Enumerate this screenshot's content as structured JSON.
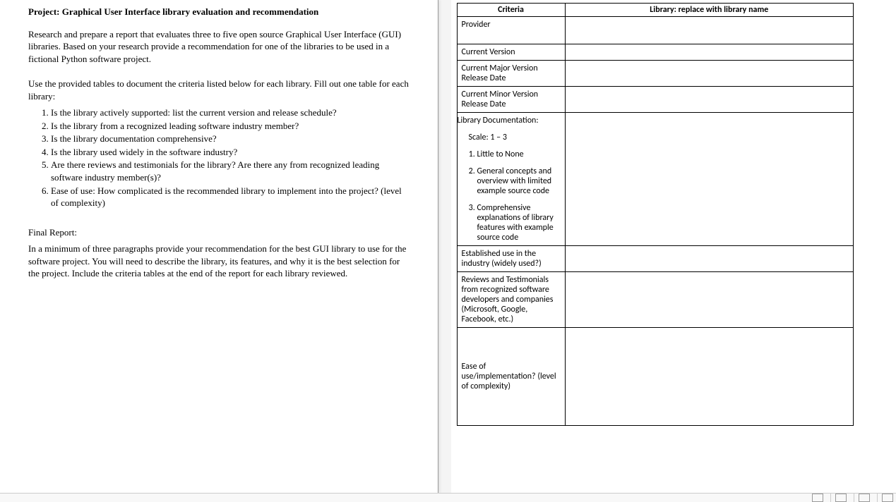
{
  "left": {
    "title": "Project: Graphical User Interface library evaluation and recommendation",
    "intro": "Research and prepare a report that evaluates three to five open source Graphical User Interface (GUI) libraries.  Based on your research provide a recommendation for one of the libraries to be used in a fictional Python software project.",
    "tables_note": "Use the provided tables to document the criteria listed below for each library. Fill out one table for each library:",
    "questions": [
      "Is the library actively supported: list the current version and release schedule?",
      "Is the library from a recognized leading software industry member?",
      "Is the library documentation comprehensive?",
      "Is the library used widely in the software industry?",
      "Are there reviews and testimonials for the library?  Are there any from recognized leading software industry member(s)?",
      "Ease of use: How complicated is the recommended library to implement into the project? (level of complexity)"
    ],
    "final_label": "Final Report:",
    "final_body": "In a minimum of three paragraphs provide your recommendation for the best GUI library to use for the software project.  You will need to describe the library, its features, and why it is the best selection for the project.  Include the criteria tables at the end of the report for each library reviewed."
  },
  "right": {
    "header_criteria": "Criteria",
    "header_library": "Library: replace with library name",
    "rows": {
      "provider": "Provider",
      "cur_ver": "Current Version",
      "cur_major": "Current Major Version Release Date",
      "cur_minor": "Current Minor Version Release Date",
      "established": "Established use in the industry (widely used?)",
      "reviews": "Reviews and Testimonials from recognized software developers and companies (Microsoft, Google, Facebook, etc.)",
      "ease": "Ease of use/implementation? (level of complexity)"
    },
    "doc": {
      "head": "Library Documentation:",
      "scale": "Scale: 1 – 3",
      "items": [
        "Little to None",
        "General concepts and overview with limited example source code",
        "Comprehensive explanations of library features with example source code"
      ]
    }
  }
}
